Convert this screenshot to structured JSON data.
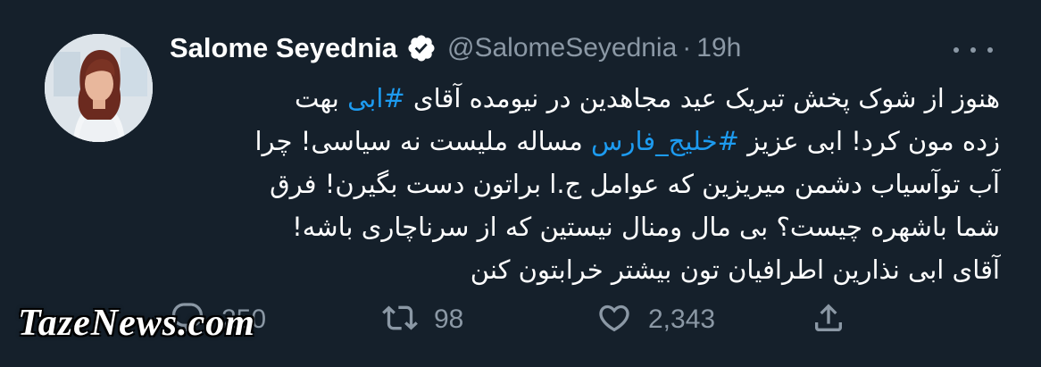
{
  "author": {
    "name": "Salome Seyednia",
    "handle": "@SalomeSeyednia",
    "separator": "·",
    "time": "19h",
    "verified": true
  },
  "tweet": {
    "line1_before": "هنوز از شوک پخش تبریک عید مجاهدین در نیومده آقای ",
    "hashtag1": "#ابی",
    "line1_after": " بهت",
    "line2_before": "زده مون کرد! ابی عزیز ",
    "hashtag2": "#خلیج_فارس",
    "line2_after": " مساله ملیست نه سیاسی! چرا",
    "line3": "آب توآسیاب دشمن میریزین که عوامل ج.ا براتون دست بگیرن! فرق",
    "line4": "شما باشهره چیست؟ بی مال ومنال نیستین که از سرناچاری باشه!",
    "line5": "آقای ابی نذارین اطرافیان تون بیشتر خرابتون کنن"
  },
  "actions": {
    "reply_count": "250",
    "retweet_count": "98",
    "like_count": "2,343"
  },
  "icons": {
    "verified": "verified-badge-icon",
    "more": "more-dots-icon",
    "reply": "reply-icon",
    "retweet": "retweet-icon",
    "like": "heart-icon",
    "share": "share-icon"
  },
  "watermark": "TazeNews.com",
  "colors": {
    "background": "#15202b",
    "text": "#ffffff",
    "secondary": "#8b98a5",
    "hashtag": "#1d9bf0"
  }
}
